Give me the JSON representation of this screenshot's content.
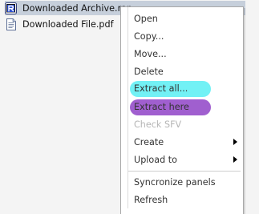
{
  "file_list": {
    "items": [
      {
        "name": "Downloaded Archive.rar",
        "icon": "rar-archive-icon",
        "selected": true
      },
      {
        "name": "Downloaded File.pdf",
        "icon": "pdf-file-icon",
        "selected": false
      }
    ]
  },
  "context_menu": {
    "items": [
      {
        "label": "Open",
        "enabled": true
      },
      {
        "label": "Copy...",
        "enabled": true
      },
      {
        "label": "Move...",
        "enabled": true
      },
      {
        "label": "Delete",
        "enabled": true
      },
      {
        "label": "Extract all...",
        "enabled": true,
        "highlight_color": "#72f1f5"
      },
      {
        "label": "Extract here",
        "enabled": true,
        "highlight_color": "#a05fcf"
      },
      {
        "label": "Check SFV",
        "enabled": false
      },
      {
        "label": "Create",
        "enabled": true,
        "has_submenu": true
      },
      {
        "label": "Upload to",
        "enabled": true,
        "has_submenu": true
      },
      {
        "label": "Syncronize panels",
        "enabled": true
      },
      {
        "label": "Refresh",
        "enabled": true
      }
    ]
  },
  "colors": {
    "panel_background": "#f4f4f4",
    "selected_row": "#c6cfdb",
    "menu_background": "#ffffff",
    "disabled_text": "#b6b6b6"
  }
}
